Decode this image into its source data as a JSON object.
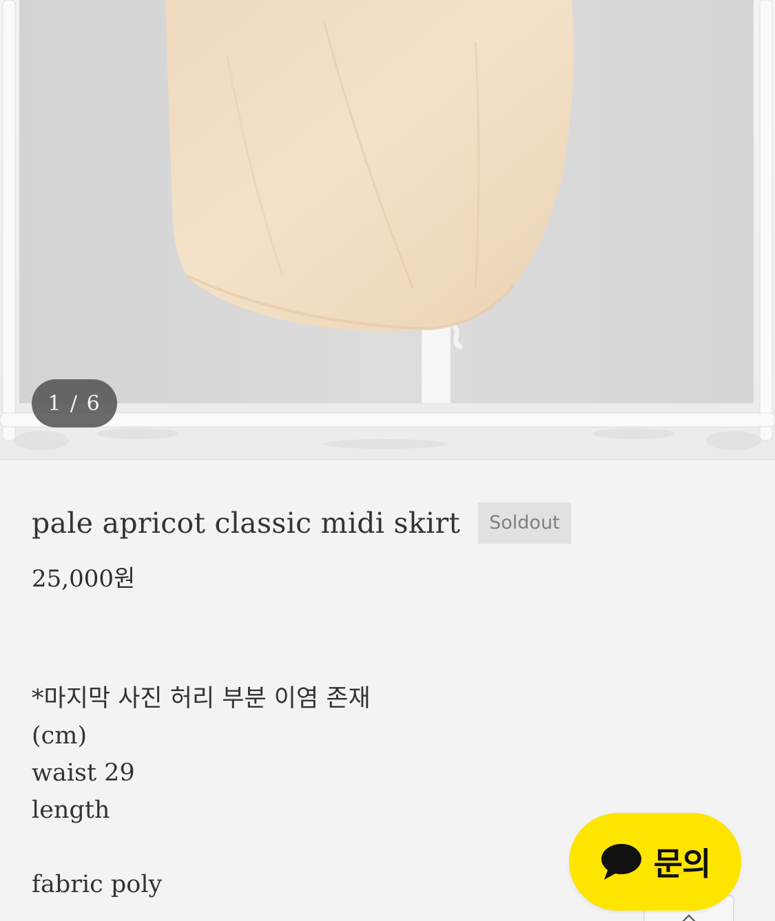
{
  "gallery": {
    "counter": "1 / 6",
    "image_alt": "pale apricot classic midi skirt"
  },
  "product": {
    "title": "pale apricot classic midi skirt",
    "badge": "Soldout",
    "price": "25,000원"
  },
  "description": {
    "lines": [
      "*마지막 사진 허리 부분 이염 존재",
      "(cm)",
      "waist 29",
      "length",
      "",
      "fabric poly"
    ]
  },
  "chat_button": {
    "label": "문의",
    "icon": "chat-bubble-icon",
    "color": "#fee500"
  },
  "scroll_top": {
    "icon": "chevron-up-icon"
  },
  "colors": {
    "skirt": "#f1dcc0",
    "background": "#f3f3f3",
    "badge_bg": "#e1e1e1"
  }
}
